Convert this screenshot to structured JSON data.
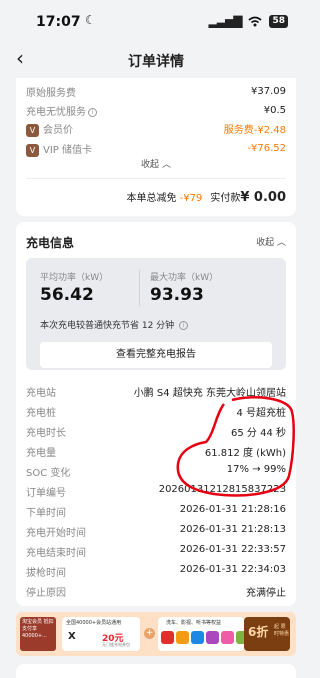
{
  "status": {
    "time": "17:07",
    "battery": "58"
  },
  "nav": {
    "title": "订单详情"
  },
  "fees": [
    {
      "label": "原始服务费",
      "value": "¥37.09"
    },
    {
      "label": "充电无忧服务",
      "value": "¥0.5"
    },
    {
      "label": "会员价",
      "value": "服务费-¥2.48"
    },
    {
      "label": "VIP 储值卡",
      "value": "-¥76.52"
    }
  ],
  "fees_collapse": "收起",
  "total": {
    "discount_label": "本单总减免",
    "discount_value": "-¥79",
    "paid_label": "实付款",
    "paid_value": "¥ 0.00"
  },
  "charge_info": {
    "title": "充电信息",
    "collapse": "收起",
    "avg_power_label": "平均功率（kW）",
    "avg_power": "56.42",
    "max_power_label": "最大功率（kW）",
    "max_power": "93.93",
    "note": "本次充电较普通快充节省 12 分钟",
    "report_button": "查看完整充电报告"
  },
  "details": [
    {
      "label": "充电站",
      "value": "小鹏 S4 超快充 东莞大岭山领居站"
    },
    {
      "label": "充电桩",
      "value": "4 号超充桩"
    },
    {
      "label": "充电时长",
      "value": "65 分 44 秒"
    },
    {
      "label": "充电量",
      "value": "61.812 度 (kWh)"
    },
    {
      "label": "SOC 变化",
      "value": "17% → 99%"
    },
    {
      "label": "订单编号",
      "value": "2026013121281583722З"
    },
    {
      "label": "下单时间",
      "value": "2026-01-31 21:28:16"
    },
    {
      "label": "充电开始时间",
      "value": "2026-01-31 21:28:13"
    },
    {
      "label": "充电结束时间",
      "value": "2026-01-31 22:33:57"
    },
    {
      "label": "拔枪时间",
      "value": "2026-01-31 22:34:03"
    },
    {
      "label": "停止原因",
      "value": "充满停止"
    }
  ],
  "banner": {
    "left_text": "淘宝会员 抵扣支付享40000+...",
    "coupon_title": "全国40000+会员站通用",
    "coupon_logo": "X",
    "coupon_amount": "20元",
    "coupon_sub": "无门槛充电券包",
    "mid_title": "洗车、影视、听书等权益",
    "right_big": "6折",
    "right_small": "起 限时特惠"
  }
}
